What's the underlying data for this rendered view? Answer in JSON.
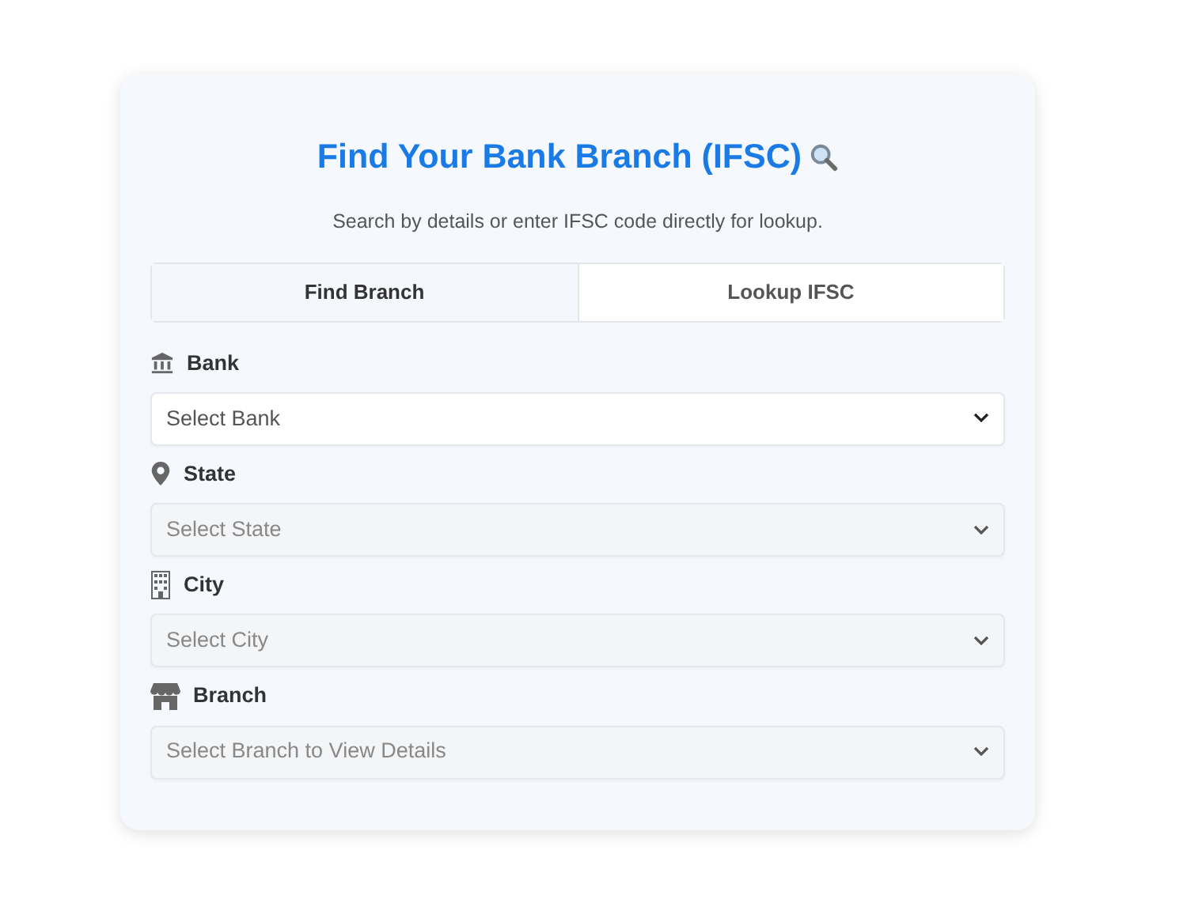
{
  "title": "Find Your Bank Branch (IFSC)",
  "subtitle": "Search by details or enter IFSC code directly for lookup.",
  "tabs": [
    {
      "label": "Find Branch",
      "selected": true
    },
    {
      "label": "Lookup IFSC",
      "selected": false
    }
  ],
  "fields": [
    {
      "kind": "bank",
      "label": "Bank",
      "placeholder": "Select Bank",
      "disabled": false
    },
    {
      "kind": "pin",
      "label": "State",
      "placeholder": "Select State",
      "disabled": true
    },
    {
      "kind": "building",
      "label": "City",
      "placeholder": "Select City",
      "disabled": true
    },
    {
      "kind": "store",
      "label": "Branch",
      "placeholder": "Select Branch to View Details",
      "disabled": true
    }
  ]
}
